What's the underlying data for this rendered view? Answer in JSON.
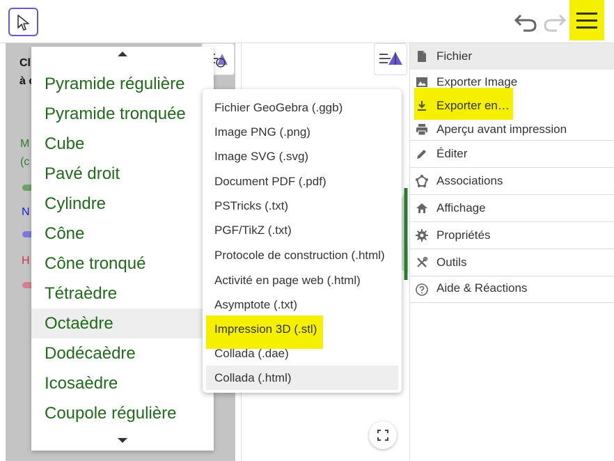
{
  "toolbar": {
    "move_tool": "move-tool",
    "undo": "undo",
    "redo": "redo",
    "menu": "menu"
  },
  "algebra": {
    "text_lines": [
      "Cl",
      "à c",
      "M",
      "(c",
      "N",
      "H"
    ]
  },
  "shapes_menu": {
    "items": [
      "Pyramide régulière",
      "Pyramide tronquée",
      "Cube",
      "Pavé droit",
      "Cylindre",
      "Cône",
      "Cône tronqué",
      "Tétraèdre",
      "Octaèdre",
      "Dodécaèdre",
      "Icosaèdre",
      "Coupole régulière"
    ],
    "highlighted": "Octaèdre"
  },
  "export_menu": {
    "items": [
      "Fichier GeoGebra (.ggb)",
      "Image PNG (.png)",
      "Image SVG (.svg)",
      "Document PDF (.pdf)",
      "PSTricks (.txt)",
      "PGF/TikZ (.txt)",
      "Protocole de construction (.html)",
      "Activité en page web (.html)",
      "Asymptote (.txt)",
      "Impression 3D (.stl)",
      "Collada (.dae)",
      "Collada (.html)"
    ],
    "highlighted": "Impression 3D (.stl)",
    "hovered": "Collada (.html)"
  },
  "main_menu": {
    "header": "Fichier",
    "file_items": [
      "Exporter Image",
      "Exporter en…",
      "Aperçu avant impression"
    ],
    "items": [
      "Éditer",
      "Associations",
      "Affichage",
      "Propriétés",
      "Outils",
      "Aide & Réactions"
    ]
  },
  "colors": {
    "highlight": "#f5f000",
    "shape_text": "#1f6b1a",
    "accent": "#6557d2"
  }
}
